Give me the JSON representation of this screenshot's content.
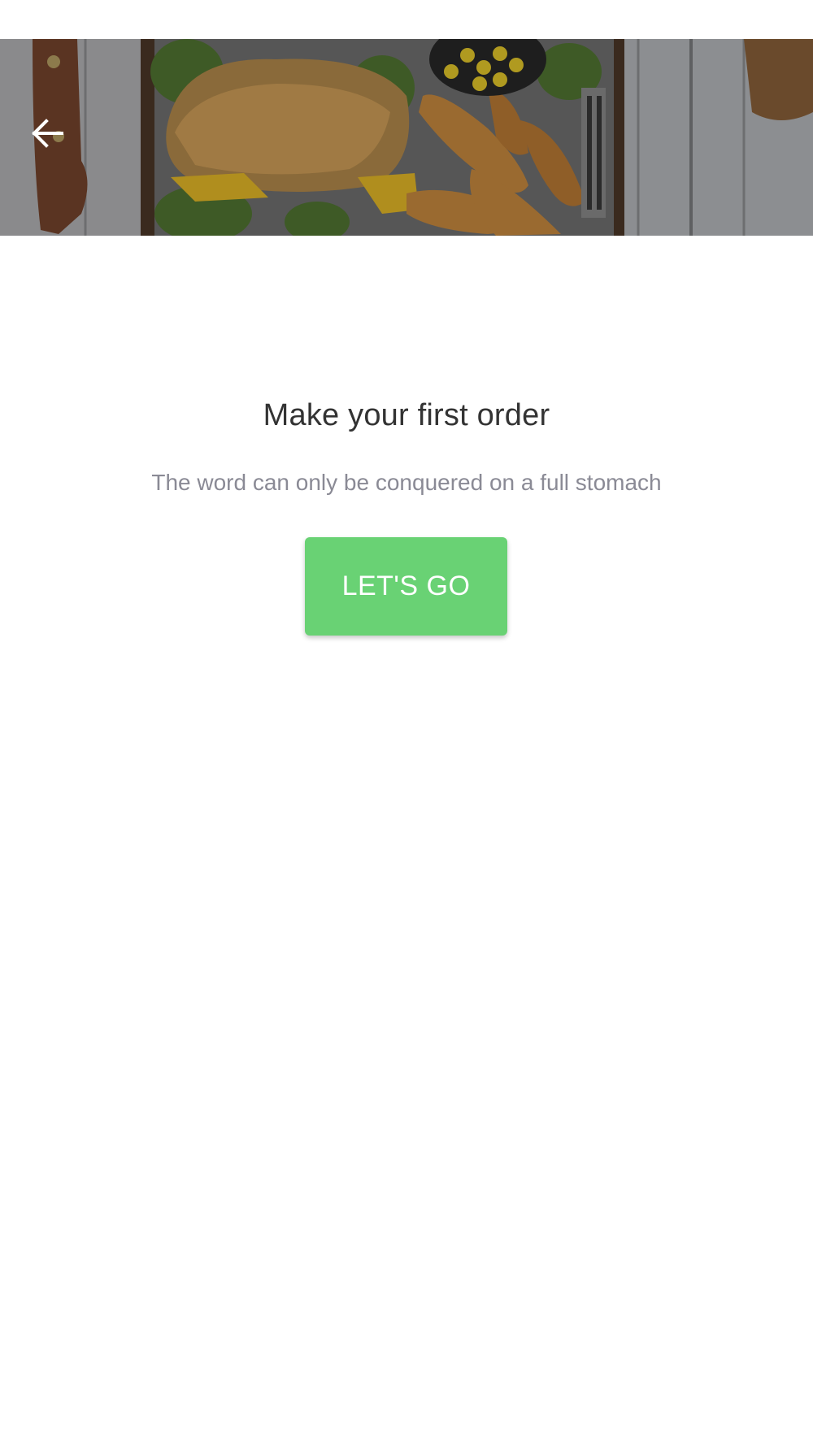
{
  "header": {
    "back_icon": "arrow-left-icon",
    "hero_image": "food-tray-with-sandwich-and-potato-wedges"
  },
  "main": {
    "title": "Make your first order",
    "subtitle": "The word can only be conquered on a full stomach",
    "cta_label": "LET'S GO"
  },
  "colors": {
    "accent": "#69d274",
    "title": "#333333",
    "subtitle": "#8a8a95",
    "background": "#ffffff"
  }
}
